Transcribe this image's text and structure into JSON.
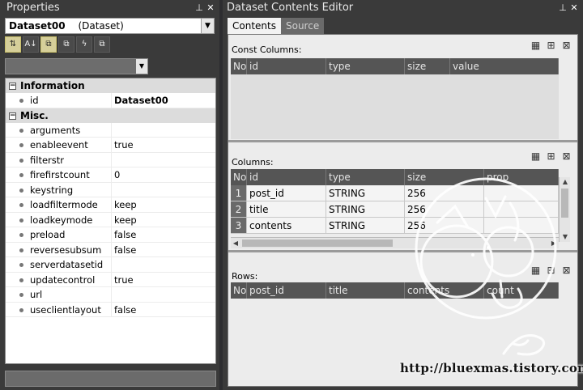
{
  "properties": {
    "title": "Properties",
    "title_buttons": [
      "📌",
      "✕"
    ],
    "object_name": "Dataset00",
    "object_type": "(Dataset)",
    "toolbar": [
      "⇅",
      "A↓",
      "⧉",
      "⧉",
      "ϟ",
      "⧉"
    ],
    "categories": [
      {
        "name": "Information",
        "rows": [
          {
            "name": "id",
            "value": "Dataset00",
            "bold": true
          }
        ]
      },
      {
        "name": "Misc.",
        "rows": [
          {
            "name": "arguments",
            "value": ""
          },
          {
            "name": "enableevent",
            "value": "true"
          },
          {
            "name": "filterstr",
            "value": ""
          },
          {
            "name": "firefirstcount",
            "value": "0"
          },
          {
            "name": "keystring",
            "value": ""
          },
          {
            "name": "loadfiltermode",
            "value": "keep"
          },
          {
            "name": "loadkeymode",
            "value": "keep"
          },
          {
            "name": "preload",
            "value": "false"
          },
          {
            "name": "reversesubsum",
            "value": "false"
          },
          {
            "name": "serverdatasetid",
            "value": ""
          },
          {
            "name": "updatecontrol",
            "value": "true"
          },
          {
            "name": "url",
            "value": ""
          },
          {
            "name": "useclientlayout",
            "value": "false"
          }
        ]
      }
    ]
  },
  "editor": {
    "title": "Dataset Contents Editor",
    "title_buttons": [
      "📌",
      "✕"
    ],
    "tabs": [
      "Contents",
      "Source"
    ],
    "const_columns": {
      "label": "Const Columns:",
      "headers": [
        "No",
        "id",
        "type",
        "size",
        "value"
      ]
    },
    "columns": {
      "label": "Columns:",
      "headers": [
        "No",
        "id",
        "type",
        "size",
        "prop"
      ],
      "rows": [
        {
          "no": "1",
          "id": "post_id",
          "type": "STRING",
          "size": "256",
          "prop": ""
        },
        {
          "no": "2",
          "id": "title",
          "type": "STRING",
          "size": "256",
          "prop": ""
        },
        {
          "no": "3",
          "id": "contents",
          "type": "STRING",
          "size": "256",
          "prop": ""
        }
      ]
    },
    "rows_section": {
      "label": "Rows:",
      "headers": [
        "No",
        "post_id",
        "title",
        "contents",
        "count"
      ]
    }
  },
  "watermark": {
    "url": "http://bluexmas.tistory.com/"
  }
}
